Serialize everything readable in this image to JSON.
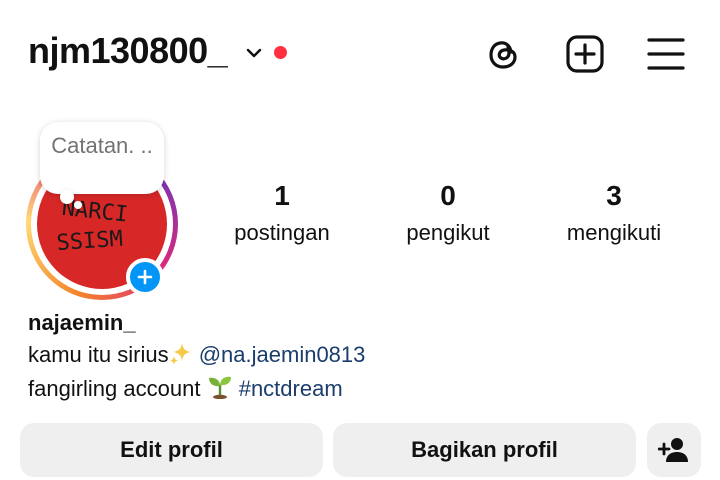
{
  "header": {
    "username": "njm130800_",
    "icons": [
      "threads-icon",
      "create-post-icon",
      "menu-icon"
    ]
  },
  "note": {
    "text": "Catatan. .."
  },
  "profile": {
    "display_name": "najaemin_",
    "stats": [
      {
        "value": "1",
        "label": "postingan"
      },
      {
        "value": "0",
        "label": "pengikut"
      },
      {
        "value": "3",
        "label": "mengikuti"
      }
    ],
    "avatar_text": [
      "NARCI",
      "SSISM"
    ],
    "bio": {
      "line1_text": "kamu itu sirius",
      "line1_mention": "@na.jaemin0813",
      "line2_text": "fangirling account",
      "line2_hashtag": "#nctdream"
    }
  },
  "actions": {
    "edit_label": "Edit profil",
    "share_label": "Bagikan profil"
  },
  "colors": {
    "notification_dot": "#ff3040",
    "add_story_badge": "#0095f6",
    "link": "#1a3d6b",
    "button_bg": "#efefef",
    "avatar_bg": "#d72727"
  }
}
